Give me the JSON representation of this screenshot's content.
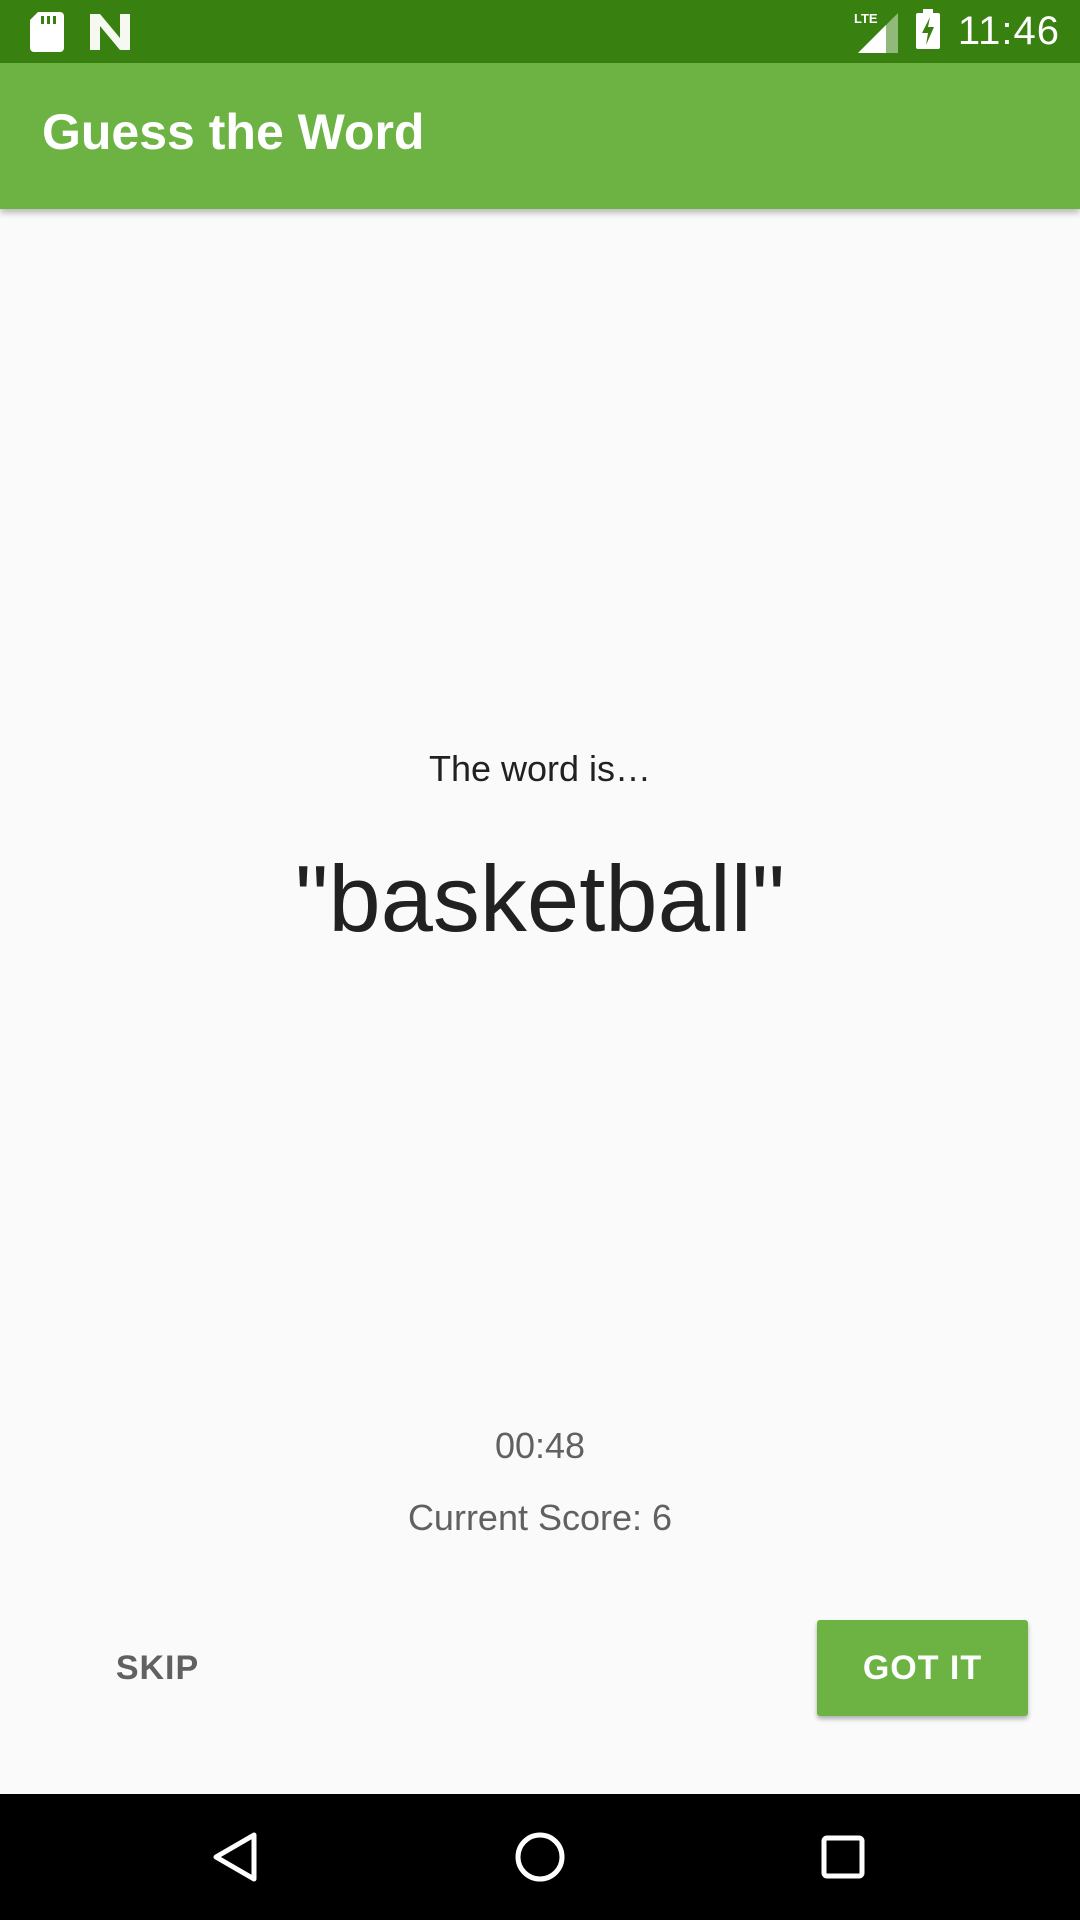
{
  "status_bar": {
    "time": "11:46",
    "network": "LTE",
    "icons": [
      "sd-card-icon",
      "n-notification-icon",
      "signal-icon",
      "battery-charging-icon"
    ]
  },
  "app_bar": {
    "title": "Guess the Word"
  },
  "game": {
    "word_label": "The word is…",
    "word": "\"basketball\"",
    "timer": "00:48",
    "score": "Current Score: 6"
  },
  "buttons": {
    "skip": "SKIP",
    "got_it": "GOT IT"
  },
  "nav_bar": {
    "icons": [
      "back-icon",
      "home-icon",
      "recents-icon"
    ]
  },
  "colors": {
    "status_bar": "#38800f",
    "primary": "#6db343",
    "background": "#fafafa",
    "text_primary": "#212121",
    "text_secondary": "#616161"
  }
}
